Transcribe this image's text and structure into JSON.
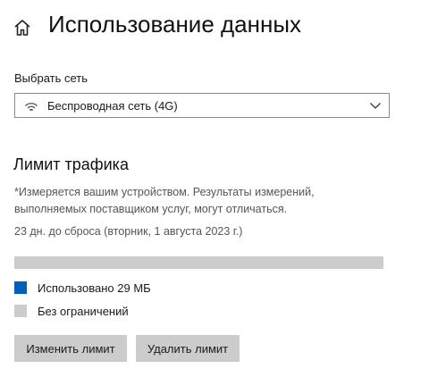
{
  "header": {
    "title": "Использование данных",
    "home_icon": "home-icon"
  },
  "network": {
    "label": "Выбрать сеть",
    "selected": "Беспроводная сеть (4G)",
    "icon": "wifi-signal-icon",
    "dropdown_icon": "chevron-down-icon"
  },
  "limit": {
    "title": "Лимит трафика",
    "note": "*Измеряется вашим устройством. Результаты измерений, выполняемых поставщиком услуг, могут отличаться.",
    "reset_info": "23 дн. до сброса (вторник, 1 августа 2023 г.)",
    "usage_fraction": 0.0,
    "legend_used": "Использовано 29 МБ",
    "legend_limit": "Без ограничений",
    "colors": {
      "used": "#005fb8",
      "remaining": "#cccccc"
    },
    "buttons": {
      "change": "Изменить лимит",
      "delete": "Удалить лимит"
    }
  }
}
